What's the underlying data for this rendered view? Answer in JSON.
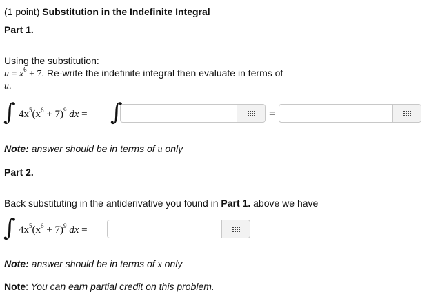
{
  "header": {
    "points": "(1 point)",
    "title": "Substitution in the Indefinite Integral"
  },
  "part1": {
    "heading": "Part 1.",
    "intro": "Using the substitution:",
    "sub_u": "u",
    "sub_eq": " = ",
    "sub_x": "x",
    "sub_exp": "6",
    "sub_rest": " + 7.",
    "sub_tail": " Re-write the indefinite integral then evaluate in terms of",
    "u_line": "u",
    "u_dot": ".",
    "integrand_coef": "4x",
    "integrand_exp1": "5",
    "integrand_paren": "(x",
    "integrand_exp2": "6",
    "integrand_plus": " + 7)",
    "integrand_exp3": "9",
    "dx": " dx",
    "equals": " = ",
    "equals2": "=",
    "note_label": "Note:",
    "note_text": " answer should be in terms of ",
    "note_var": "u",
    "note_end": " only",
    "input1_value": "",
    "input2_value": "",
    "icon": "equation-grid-icon"
  },
  "part2": {
    "heading": "Part 2.",
    "intro_start": "Back substituting in the antiderivative you found in ",
    "intro_bold": "Part 1.",
    "intro_end": " above we have",
    "integrand_coef": "4x",
    "integrand_exp1": "5",
    "integrand_paren": "(x",
    "integrand_exp2": "6",
    "integrand_plus": " + 7)",
    "integrand_exp3": "9",
    "dx": " dx",
    "equals": " = ",
    "note_label": "Note:",
    "note_text": " answer should be in terms of ",
    "note_var": "x",
    "note_end": " only",
    "input_value": ""
  },
  "footer": {
    "label": "Note",
    "colon": ":",
    "text": " You can earn partial credit on this problem."
  }
}
